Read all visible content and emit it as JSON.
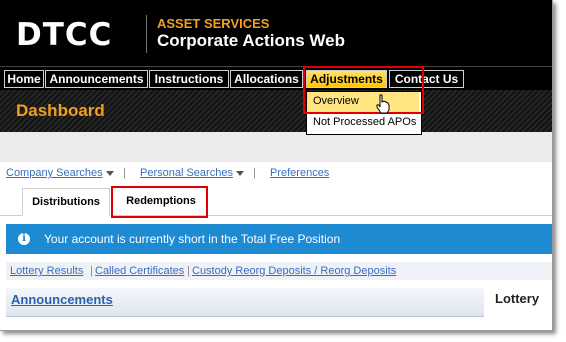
{
  "header": {
    "logo": "DTCC",
    "service": "ASSET SERVICES",
    "app_title": "Corporate Actions Web"
  },
  "nav": {
    "items": [
      "Home",
      "Announcements",
      "Instructions",
      "Allocations",
      "Adjustments",
      "Contact Us"
    ],
    "active": "Adjustments"
  },
  "dropdown": {
    "items": [
      "Overview",
      "Not Processed APOs"
    ]
  },
  "dashboard": {
    "title": "Dashboard"
  },
  "search_links": {
    "company": "Company Searches",
    "personal": "Personal Searches",
    "preferences": "Preferences",
    "separator": "|"
  },
  "tabs": [
    "Distributions",
    "Redemptions"
  ],
  "banner": {
    "icon": "info-icon",
    "text": "Your account is currently short in the Total Free Position",
    "color": "#1e8ad2"
  },
  "quick_links": {
    "items": [
      "Lottery Results",
      "Called Certificates",
      "Custody Reorg Deposits / Reorg Deposits"
    ],
    "separator": "|"
  },
  "panels": {
    "announcements_title": "Announcements",
    "lottery_title": "Lottery"
  },
  "colors": {
    "accent": "#f0a01e",
    "highlight_box": "#e00000",
    "link": "#3a6dbf"
  }
}
